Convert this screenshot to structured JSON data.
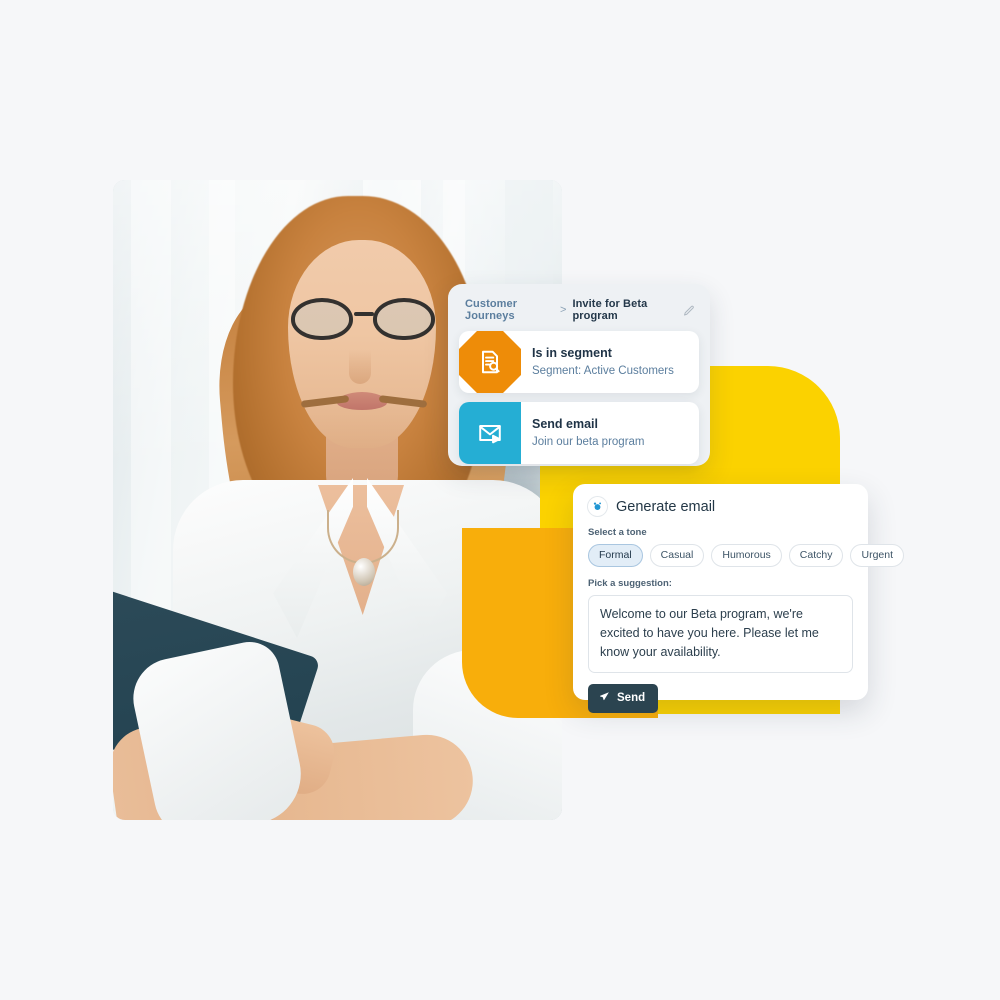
{
  "page": {
    "background_color": "#f6f7f9"
  },
  "photo": {
    "alt": "woman-with-glasses-holding-tablet"
  },
  "decor": {
    "yellow_color": "#fbd200",
    "amber_color": "#f8ae0b"
  },
  "journey_panel": {
    "breadcrumb": {
      "root": "Customer Journeys",
      "separator": ">",
      "current": "Invite for Beta program",
      "edit_icon": "pencil-icon"
    },
    "steps": [
      {
        "icon": "segment-document-search-icon",
        "icon_shape": "octagon",
        "icon_color": "#ee8c08",
        "title": "Is in segment",
        "subtitle": "Segment: Active Customers"
      },
      {
        "icon": "send-email-icon",
        "icon_shape": "square",
        "icon_color": "#25aed4",
        "title": "Send email",
        "subtitle": "Join our beta program"
      }
    ]
  },
  "generate_email": {
    "badge_icon": "ai-sparkle-icon",
    "title": "Generate email",
    "tone_label": "Select a tone",
    "tones": [
      {
        "label": "Formal",
        "selected": true
      },
      {
        "label": "Casual",
        "selected": false
      },
      {
        "label": "Humorous",
        "selected": false
      },
      {
        "label": "Catchy",
        "selected": false
      },
      {
        "label": "Urgent",
        "selected": false
      }
    ],
    "suggestion_label": "Pick a suggestion:",
    "suggestion_text": "Welcome to our Beta program, we're excited to have you here. Please let me know your availability.",
    "send_button": {
      "label": "Send",
      "icon": "paper-plane-icon",
      "color": "#2b4450"
    }
  }
}
